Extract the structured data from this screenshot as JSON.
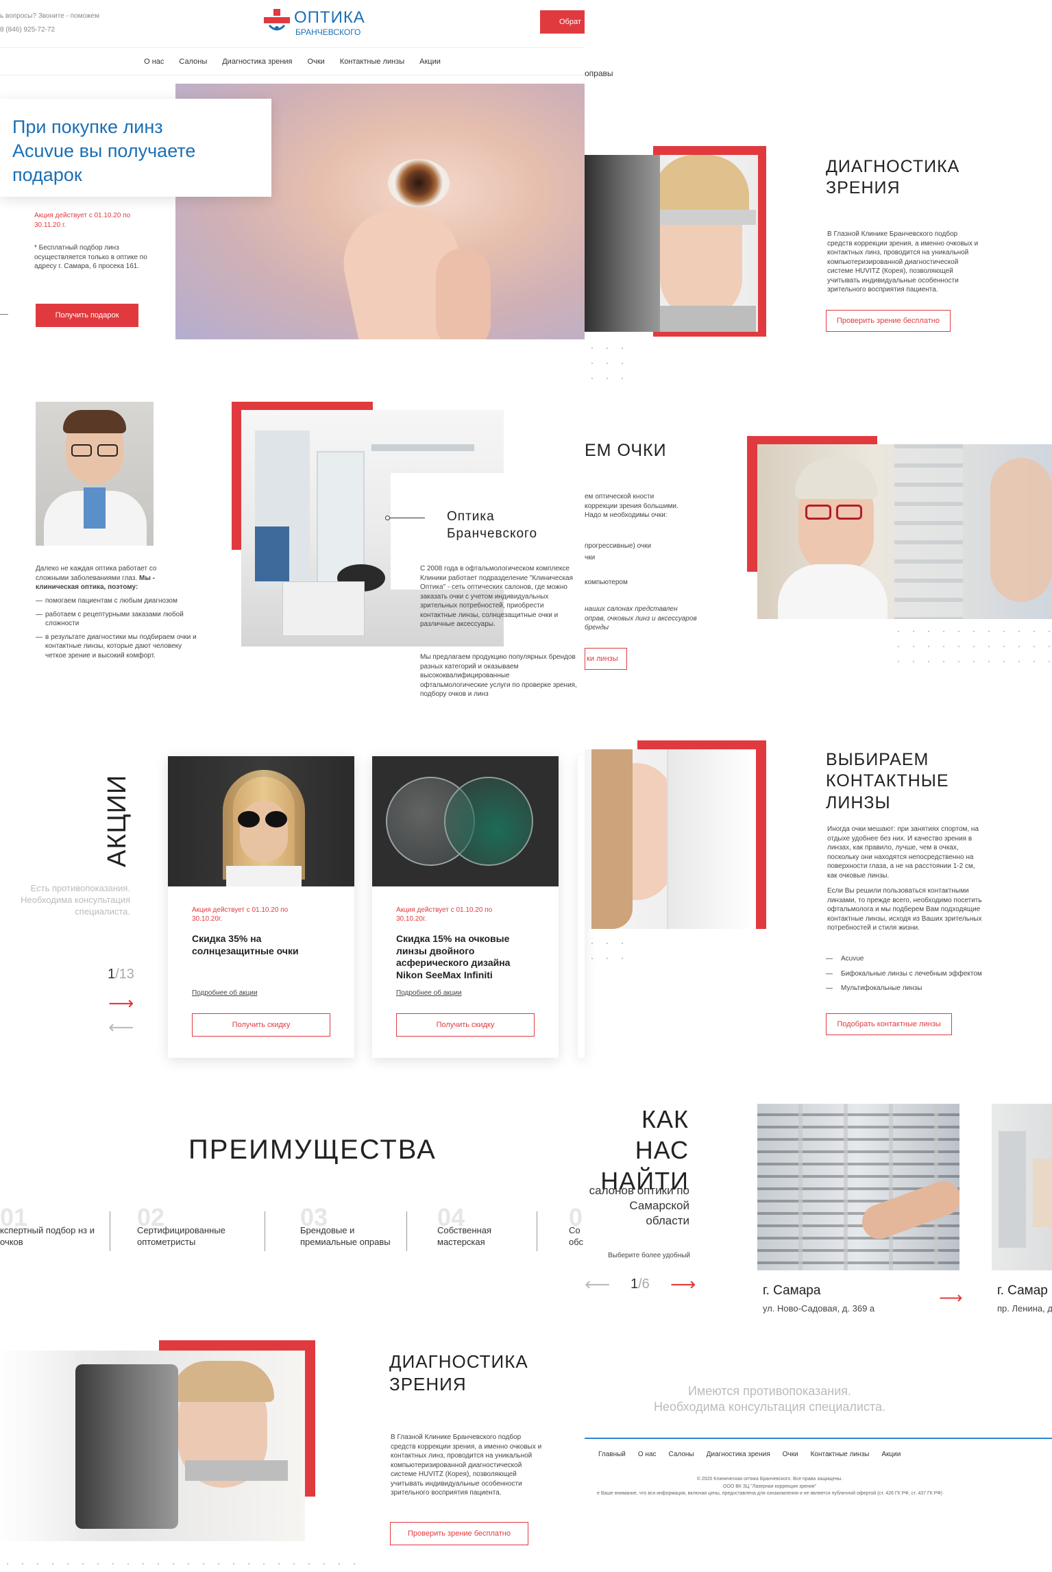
{
  "header": {
    "questions": "ь вопросы? Звоните - поможем",
    "phone": "8 (846) 925-72-72",
    "logo_top": "ОПТИКА",
    "logo_bottom": "БРАНЧЕВСКОГО",
    "cta": "Обрат"
  },
  "nav": [
    "О нас",
    "Салоны",
    "Диагностика зрения",
    "Очки",
    "Контактные линзы",
    "Акции"
  ],
  "hero": {
    "line1": "При покупке линз",
    "brand": "Acuvue",
    "line2": " вы получаете",
    "line3": "подарок",
    "period": "Акция действует с 01.10.20 по 30.11.20 г.",
    "note": "* Бесплатный подбор линз осуществляется только в оптике по адресу г. Самара, 6 просека 161.",
    "button": "Получить подарок"
  },
  "top_crop_text": "оправы",
  "diag1": {
    "title1": "ДИАГНОСТИКА",
    "title2": "ЗРЕНИЯ",
    "text": "В Глазной Клинике Бранчевского подбор средств коррекции зрения, а именно очковых и контактных линз, проводится на уникальной компьютеризированной диагностической системе HUVITZ (Корея), позволяющей учитывать индивидуальные особенности зрительного восприятия пациента.",
    "button": "Проверить зрение бесплатно"
  },
  "about": {
    "intro": "Далеко не каждая оптика работает со сложными заболеваниями глаз.",
    "intro_bold": "Мы - клиническая оптика, поэтому:",
    "items": [
      "помогаем пациентам с любым диагнозом",
      "работаем с рецептурными заказами любой сложности",
      "в результате диагностики мы подбираем очки и контактные линзы, которые дают человеку четкое зрение и высокий комфорт."
    ],
    "title1": "Оптика",
    "title2": "Бранчевского",
    "p1": "С 2008 года в офтальмологическом комплексе Клиники работает подразделение \"Клиническая Оптика\" - сеть оптических салонов, где можно заказать очки с учетом индивидуальных зрительных потребностей, приобрести контактные линзы, солнцезащитные очки и различные аксессуары.",
    "p2": "Мы предлагаем продукцию популярных брендов разных категорий и оказываем высококвалифицированные офтальмологические услуги по проверке зрения, подбору очков и линз"
  },
  "glasses": {
    "title": "ЕМ ОЧКИ",
    "text1": "ем оптической кности коррекции зрения большими. Надо м необходимы очки:",
    "items": [
      "прогрессивные) очки",
      "чки",
      "компьютером"
    ],
    "note": "наших салонах представлен оправ, очковых линз и аксессуаров бренды",
    "button": "ки линзы"
  },
  "promo": {
    "title": "АКЦИИ",
    "note": "Есть противопоказания. Необходима консультация специалиста.",
    "counter_cur": "1",
    "counter_total": "/13",
    "cards": [
      {
        "period": "Акция действует с 01.10.20 по 30.10.20г.",
        "title": "Скидка 35% на солнцезащитные очки",
        "link": "Подробнее об акции",
        "button": "Получить скидку"
      },
      {
        "period": "Акция действует с 01.10.20 по 30.10.20г.",
        "title": "Скидка 15% на очковые линзы двойного асферического дизайна Nikon SeeMax Infiniti",
        "link": "Подробнее об акции",
        "button": "Получить скидку"
      }
    ]
  },
  "contacts": {
    "title1": "ВЫБИРАЕМ",
    "title2": "КОНТАКТНЫЕ",
    "title3": "ЛИНЗЫ",
    "p1": "Иногда очки мешают: при занятиях спортом, на отдыхе удобнее без них. И качество зрения в линзах, как правило, лучше, чем в очках, поскольку они находятся непосредственно на поверхности глаза, а не на расстоянии 1-2 см, как очковые линзы.",
    "p2": "Если Вы решили пользоваться контактными линзами, то прежде всего, необходимо посетить офтальмолога и мы подберем Вам подходящие контактные линзы, исходя из Ваших зрительных потребностей и стиля жизни.",
    "items": [
      "Acuvue",
      "Бифокальные линзы с лечебным эффектом",
      "Мультифокальные линзы"
    ],
    "button": "Подобрать контактные линзы"
  },
  "advantages": {
    "title": "ПРЕИМУЩЕСТВА",
    "items": [
      {
        "num": "01",
        "text": "кспертный подбор нз и очков"
      },
      {
        "num": "02",
        "text": "Сертифицированные оптометристы"
      },
      {
        "num": "03",
        "text": "Брендовые и премиальные оправы"
      },
      {
        "num": "04",
        "text": "Собственная мастерская"
      },
      {
        "num": "0",
        "text": "Со обс"
      }
    ]
  },
  "find": {
    "title1": "КАК НАС",
    "title2": "НАЙТИ",
    "sub": "салонов оптики по Самарской области",
    "hint": "Выберите более удобный",
    "counter_cur": "1",
    "counter_total": "/6",
    "salons": [
      {
        "city": "г. Самара",
        "address": "ул. Ново-Садовая, д. 369 а"
      },
      {
        "city": "г. Самар",
        "address": "пр. Ленина, д"
      }
    ]
  },
  "diag2": {
    "title1": "ДИАГНОСТИКА",
    "title2": "ЗРЕНИЯ",
    "text": "В Глазной Клинике Бранчевского подбор средств коррекции зрения, а именно очковых и контактных линз, проводится на уникальной компьютеризированной диагностической системе HUVITZ (Корея), позволяющей учитывать индивидуальные особенности зрительного восприятия пациента.",
    "button": "Проверить зрение бесплатно"
  },
  "footer": {
    "warning1": "Имеются противопоказания.",
    "warning2": "Необходима консультация специалиста.",
    "menu": [
      "Главный",
      "О нас",
      "Салоны",
      "Диагностика зрения",
      "Очки",
      "Контактные линзы",
      "Акции"
    ],
    "copy1": "© 2020 Клиническая оптика Бранчевского. Все права защищены.",
    "copy2": "ООО ВК ЗЦ \"Лазерная коррекция зрения\"",
    "copy3": "е Ваше внимание, что вся информация, включая цены, предоставлена для ознакомления и не является публичной офертой (ст. 426 ГК РФ, ст. 437 ГК РФ)"
  },
  "colors": {
    "accent": "#e03a3f",
    "brand_blue": "#1a6fb5"
  }
}
